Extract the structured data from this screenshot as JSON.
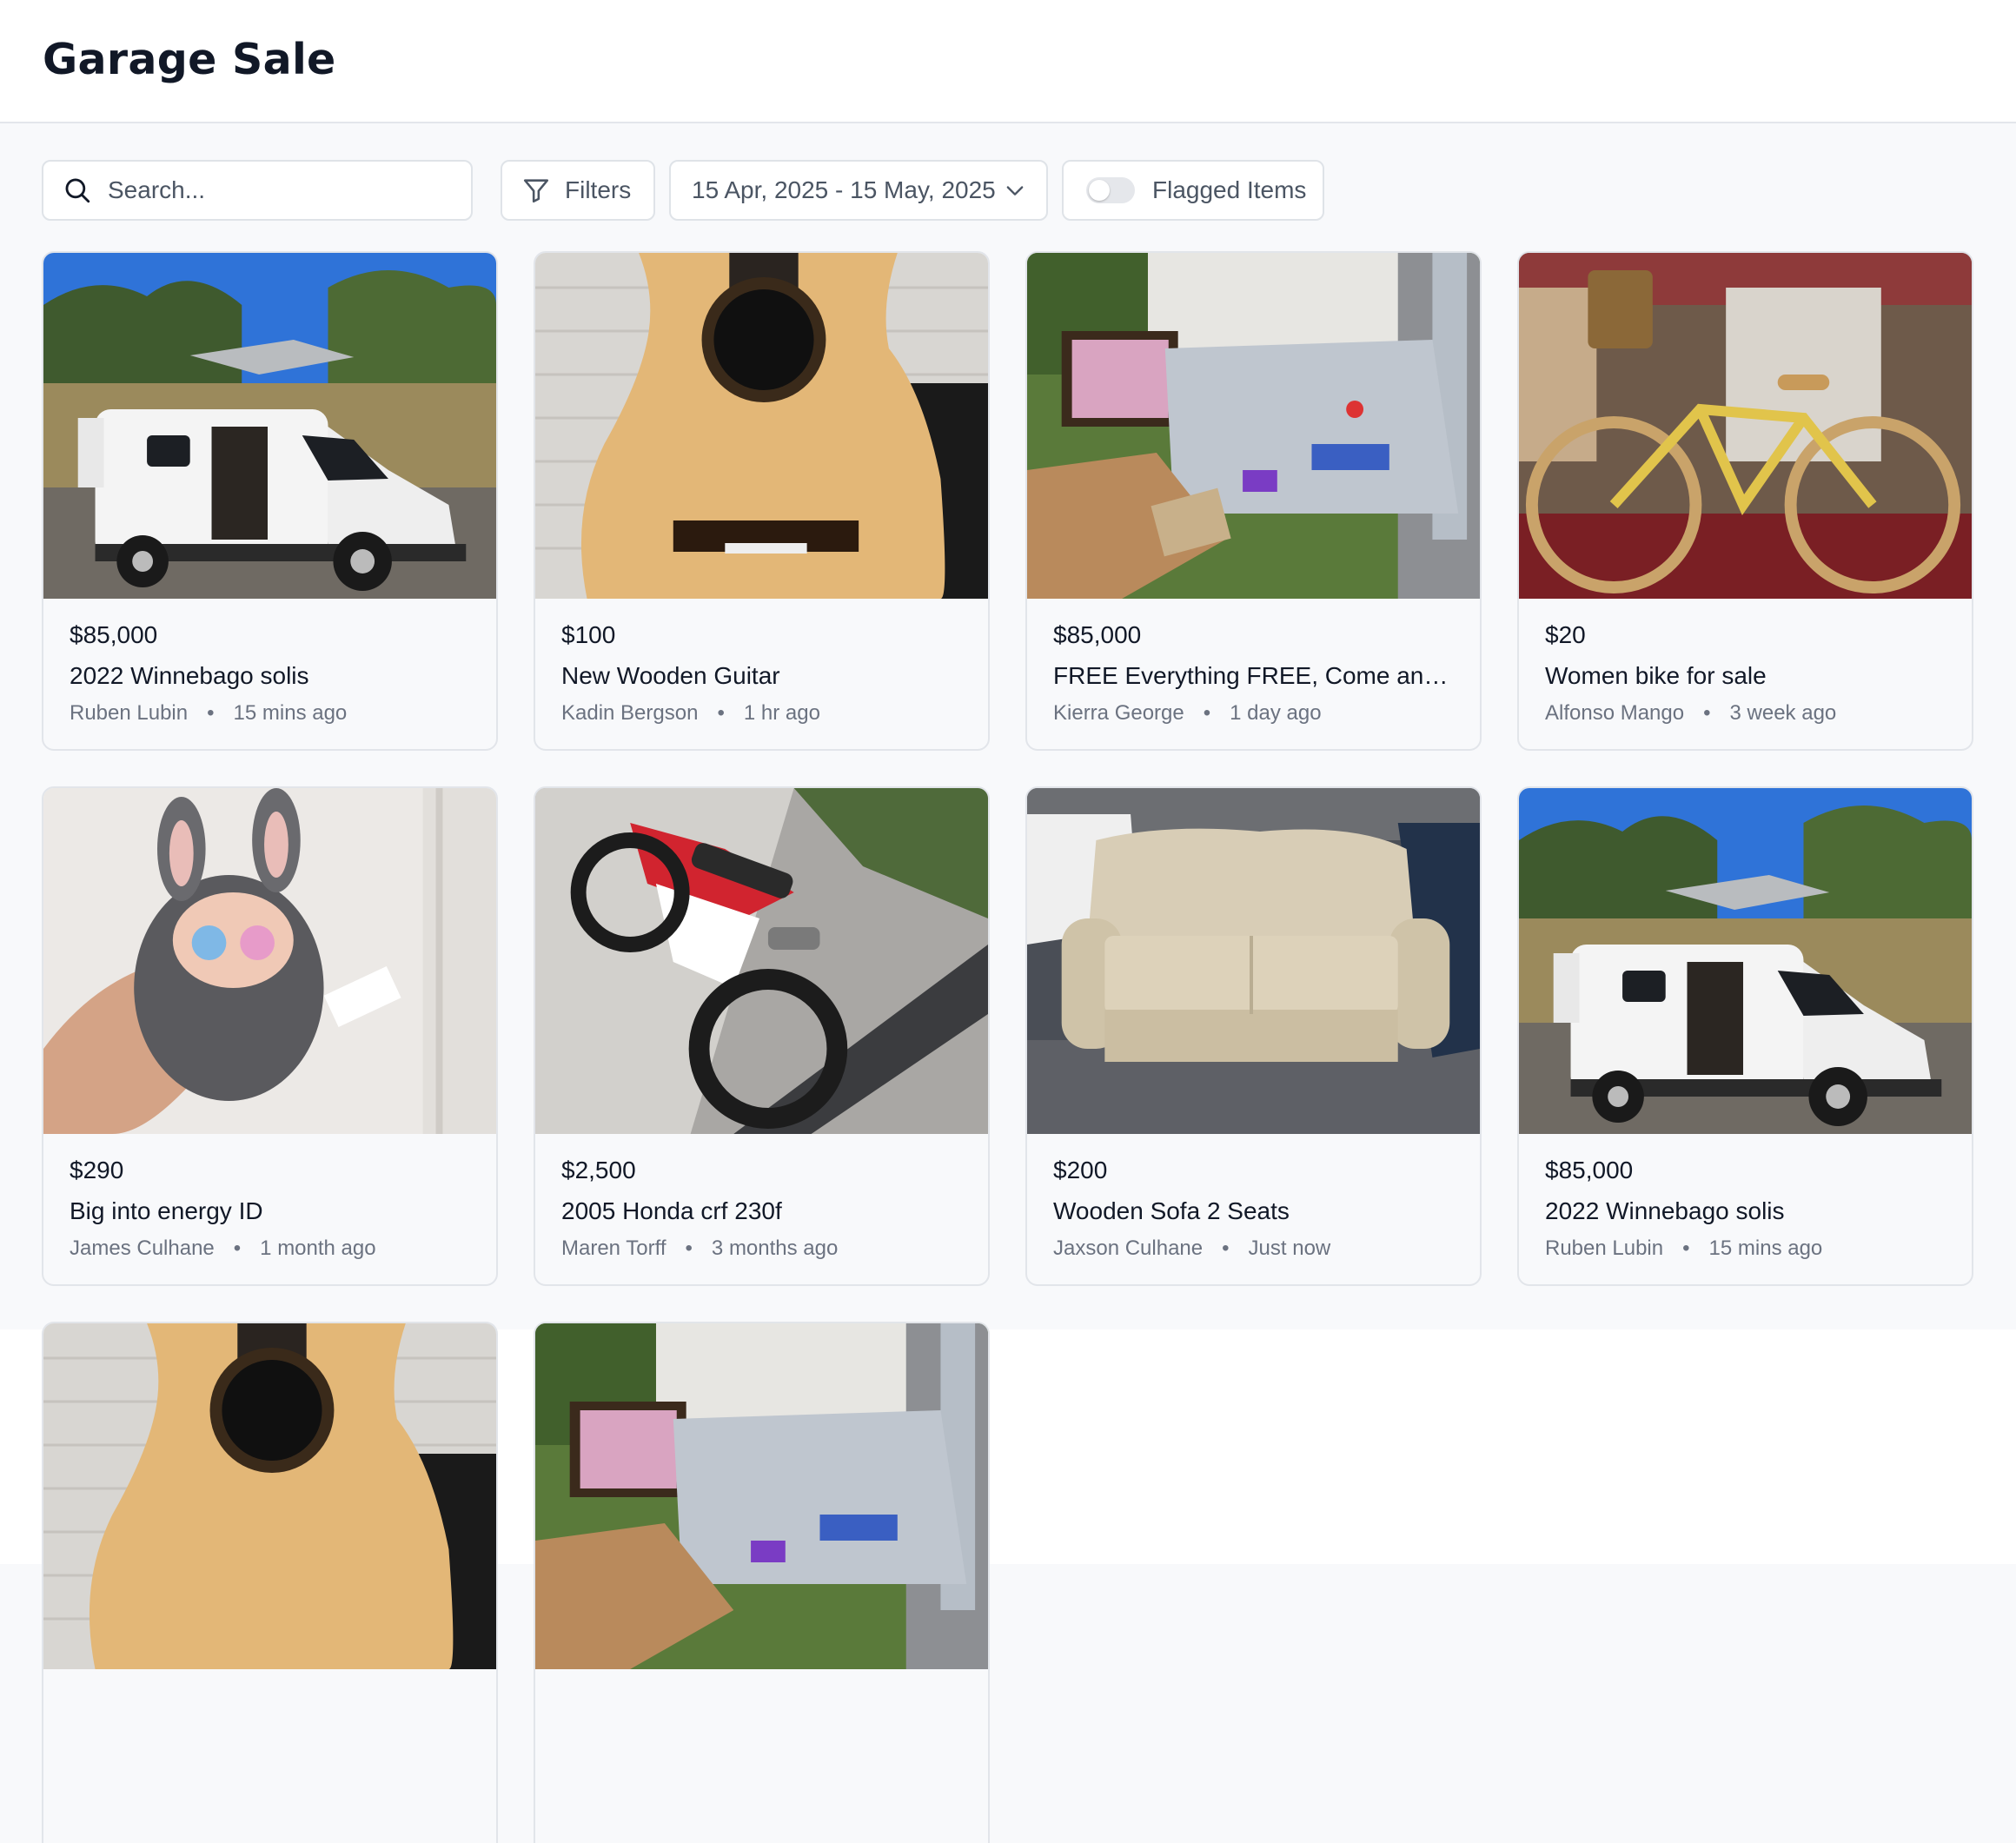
{
  "header": {
    "title": "Garage Sale"
  },
  "toolbar": {
    "search_placeholder": "Search...",
    "filters_label": "Filters",
    "date_range": "15 Apr, 2025 - 15 May, 2025",
    "flagged_label": "Flagged Items",
    "flagged_on": false
  },
  "icons": {
    "search": "search-icon",
    "filter": "filter-icon",
    "chevron": "chevron-down-icon"
  },
  "listings": [
    {
      "price": "$85,000",
      "title": "2022 Winnebago solis",
      "seller": "Ruben Lubin",
      "time": "15 mins ago",
      "image": "camper-van-photo"
    },
    {
      "price": "$100",
      "title": "New Wooden Guitar",
      "seller": "Kadin Bergson",
      "time": "1 hr ago",
      "image": "acoustic-guitar-photo"
    },
    {
      "price": "$85,000",
      "title": "FREE Everything FREE, Come and Pi...",
      "seller": "Kierra George",
      "time": "1 day ago",
      "image": "yard-sale-items-photo"
    },
    {
      "price": "$20",
      "title": "Women bike for sale",
      "seller": "Alfonso Mango",
      "time": "3 week ago",
      "image": "yellow-bicycle-photo"
    },
    {
      "price": "$290",
      "title": "Big into energy ID",
      "seller": "James Culhane",
      "time": "1 month ago",
      "image": "plush-toy-photo"
    },
    {
      "price": "$2,500",
      "title": "2005 Honda crf 230f",
      "seller": "Maren Torff",
      "time": "3 months ago",
      "image": "dirt-bike-photo"
    },
    {
      "price": "$200",
      "title": "Wooden Sofa 2 Seats",
      "seller": "Jaxson Culhane",
      "time": "Just now",
      "image": "sofa-photo"
    },
    {
      "price": "$85,000",
      "title": "2022 Winnebago solis",
      "seller": "Ruben Lubin",
      "time": "15 mins ago",
      "image": "camper-van-photo"
    },
    {
      "image": "acoustic-guitar-photo"
    },
    {
      "image": "yard-sale-items-photo"
    }
  ]
}
